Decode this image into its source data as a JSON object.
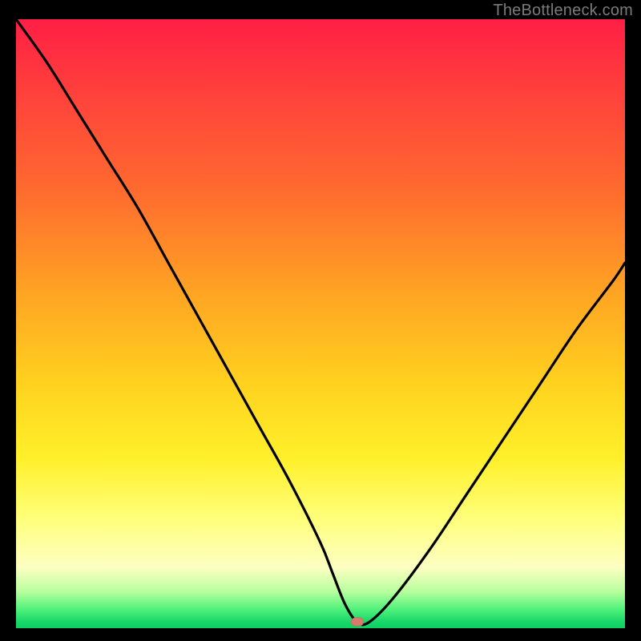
{
  "site_watermark": "TheBottleneck.com",
  "colors": {
    "frame": "#000000",
    "watermark": "#7b7b7b",
    "curve": "#000000",
    "marker": "#d87a6e",
    "gradient_stops": [
      "#ff1f45",
      "#ff3b3d",
      "#ff6a2f",
      "#ffa423",
      "#ffd21f",
      "#fff02a",
      "#ffff7a",
      "#fdffc2",
      "#b8ff9e",
      "#4cf07a",
      "#18d66a",
      "#0fcf63"
    ]
  },
  "chart_data": {
    "type": "line",
    "title": "",
    "xlabel": "",
    "ylabel": "",
    "xlim": [
      0,
      100
    ],
    "ylim": [
      0,
      100
    ],
    "legend": false,
    "grid": false,
    "annotations": [],
    "marker": {
      "x": 56,
      "y": 1
    },
    "series": [
      {
        "name": "bottleneck-curve",
        "x": [
          0,
          5,
          10,
          15,
          20,
          25,
          30,
          35,
          40,
          45,
          50,
          52,
          54,
          56,
          58,
          62,
          68,
          74,
          80,
          86,
          92,
          98,
          100
        ],
        "y": [
          100,
          93,
          85,
          77,
          69,
          60,
          51,
          42,
          33,
          24,
          14,
          9,
          4,
          1,
          1,
          5,
          13,
          22,
          31,
          40,
          49,
          57,
          60
        ]
      }
    ]
  }
}
